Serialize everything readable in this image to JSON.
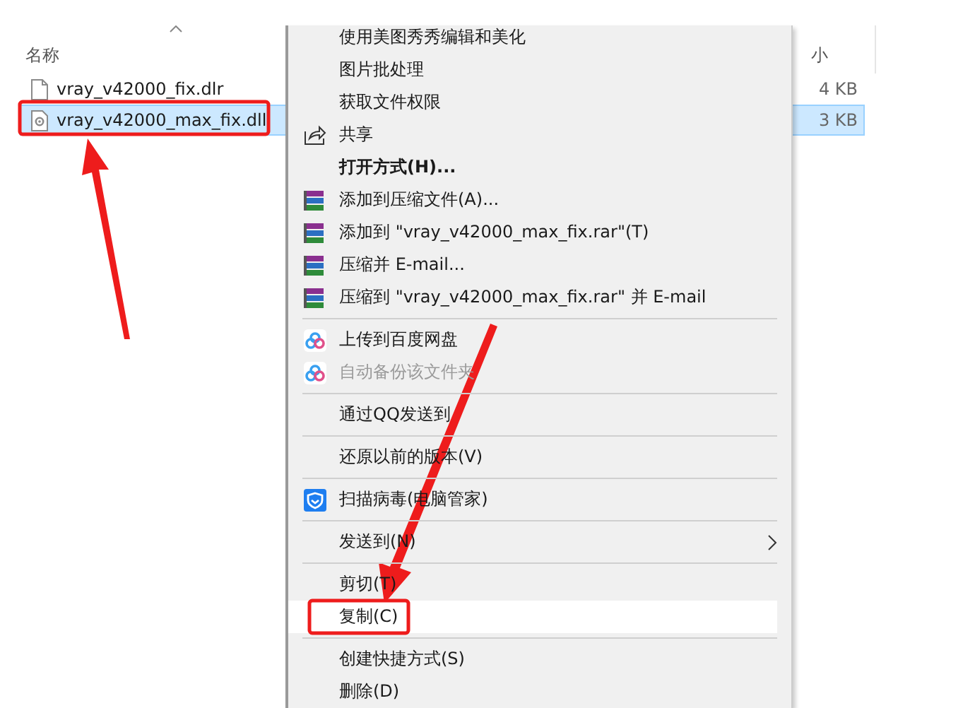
{
  "file_list": {
    "columns": [
      {
        "label": "名称"
      },
      {
        "label": "小"
      }
    ],
    "rows": [
      {
        "name": "vray_v42000_fix.dlr",
        "size": "4 KB",
        "selected": false,
        "kind": "file"
      },
      {
        "name": "vray_v42000_max_fix.dll",
        "size": "3 KB",
        "selected": true,
        "kind": "dll"
      }
    ]
  },
  "context_menu": {
    "items": [
      {
        "kind": "plain",
        "label": "使用美图秀秀编辑和美化",
        "bold": false,
        "disabled": false,
        "selected": false,
        "submenu": false
      },
      {
        "kind": "plain",
        "label": "图片批处理",
        "bold": false,
        "disabled": false,
        "selected": false,
        "submenu": false
      },
      {
        "kind": "plain",
        "label": "获取文件权限",
        "bold": false,
        "disabled": false,
        "selected": false,
        "submenu": false
      },
      {
        "kind": "share",
        "label": "共享",
        "bold": false,
        "disabled": false,
        "selected": false,
        "submenu": false
      },
      {
        "kind": "plain",
        "label": "打开方式(H)...",
        "bold": true,
        "disabled": false,
        "selected": false,
        "submenu": false
      },
      {
        "kind": "archive",
        "label": "添加到压缩文件(A)...",
        "bold": false,
        "disabled": false,
        "selected": false,
        "submenu": false
      },
      {
        "kind": "archive",
        "label": "添加到 \"vray_v42000_max_fix.rar\"(T)",
        "bold": false,
        "disabled": false,
        "selected": false,
        "submenu": false
      },
      {
        "kind": "archive",
        "label": "压缩并 E-mail...",
        "bold": false,
        "disabled": false,
        "selected": false,
        "submenu": false
      },
      {
        "kind": "archive",
        "label": "压缩到 \"vray_v42000_max_fix.rar\" 并 E-mail",
        "bold": false,
        "disabled": false,
        "selected": false,
        "submenu": false
      },
      {
        "kind": "separator"
      },
      {
        "kind": "cloud",
        "label": "上传到百度网盘",
        "bold": false,
        "disabled": false,
        "selected": false,
        "submenu": false
      },
      {
        "kind": "cloud",
        "label": "自动备份该文件夹",
        "bold": false,
        "disabled": true,
        "selected": false,
        "submenu": false
      },
      {
        "kind": "separator"
      },
      {
        "kind": "plain",
        "label": "通过QQ发送到",
        "bold": false,
        "disabled": false,
        "selected": false,
        "submenu": false
      },
      {
        "kind": "separator"
      },
      {
        "kind": "plain",
        "label": "还原以前的版本(V)",
        "bold": false,
        "disabled": false,
        "selected": false,
        "submenu": false
      },
      {
        "kind": "separator"
      },
      {
        "kind": "shield",
        "label": "扫描病毒(电脑管家)",
        "bold": false,
        "disabled": false,
        "selected": false,
        "submenu": false
      },
      {
        "kind": "separator"
      },
      {
        "kind": "plain",
        "label": "发送到(N)",
        "bold": false,
        "disabled": false,
        "selected": false,
        "submenu": true
      },
      {
        "kind": "separator"
      },
      {
        "kind": "plain",
        "label": "剪切(T)",
        "bold": false,
        "disabled": false,
        "selected": false,
        "submenu": false
      },
      {
        "kind": "plain",
        "label": "复制(C)",
        "bold": false,
        "disabled": false,
        "selected": true,
        "submenu": false
      },
      {
        "kind": "separator"
      },
      {
        "kind": "plain",
        "label": "创建快捷方式(S)",
        "bold": false,
        "disabled": false,
        "selected": false,
        "submenu": false
      },
      {
        "kind": "plain",
        "label": "删除(D)",
        "bold": false,
        "disabled": false,
        "selected": false,
        "submenu": false
      }
    ]
  }
}
